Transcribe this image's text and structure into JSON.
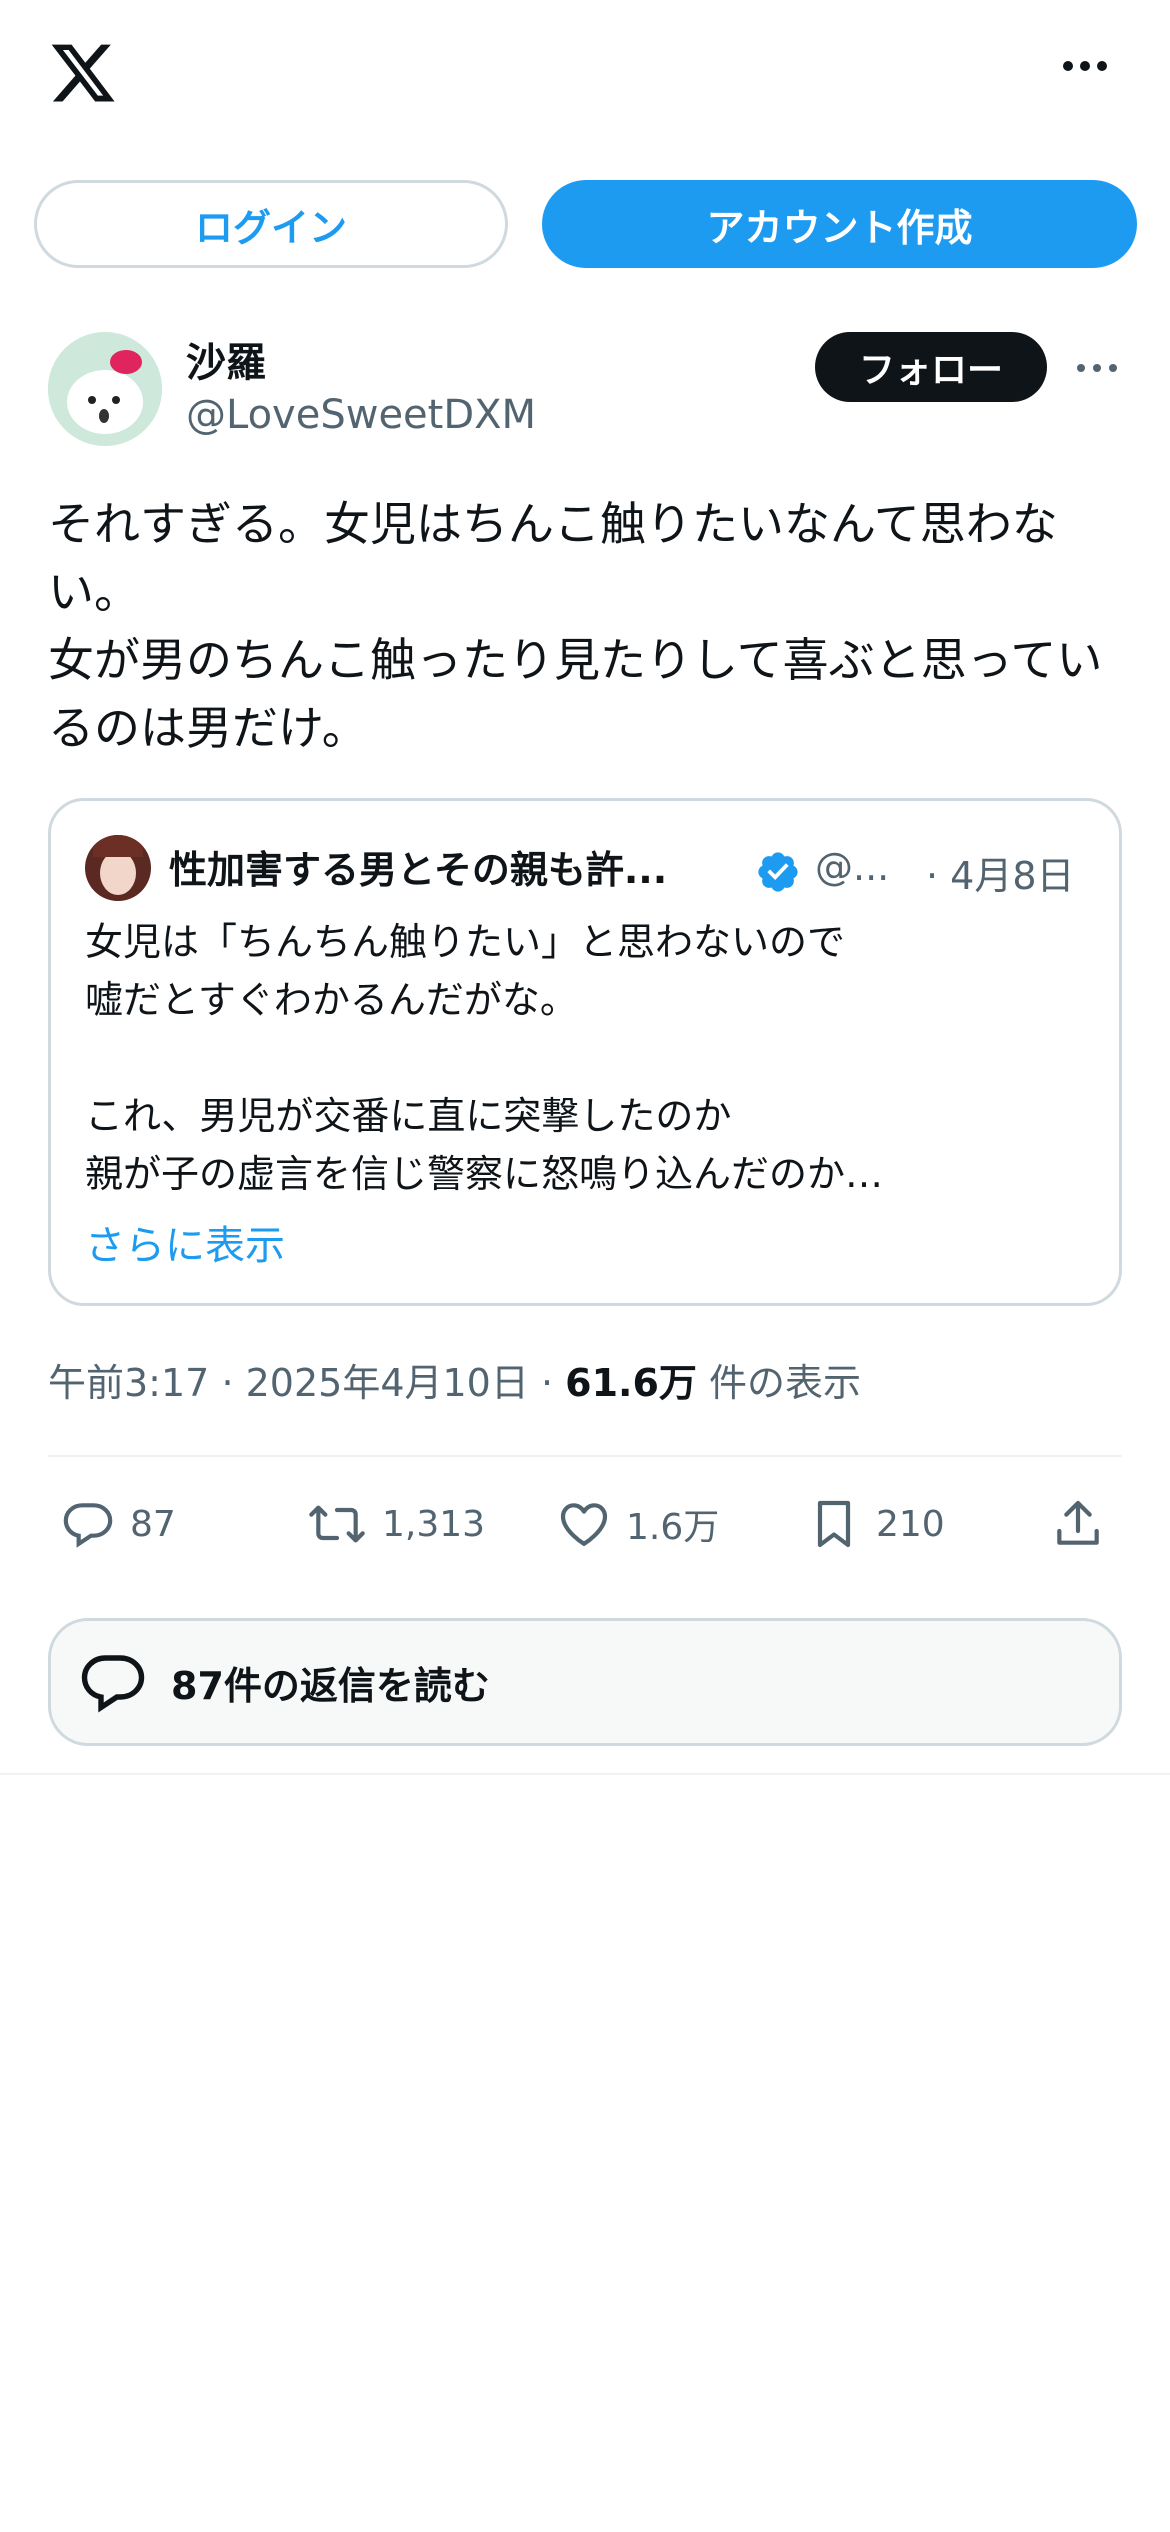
{
  "header": {
    "login_label": "ログイン",
    "signup_label": "アカウント作成"
  },
  "author": {
    "name": "沙羅",
    "handle": "@LoveSweetDXM",
    "follow_label": "フォロー"
  },
  "tweet": {
    "text": "それすぎる。女児はちんこ触りたいなんて思わない。\n女が男のちんこ触ったり見たりして喜ぶと思っているのは男だけ。"
  },
  "quote": {
    "name": "性加害する男とその親も許...",
    "handle": "@...",
    "date": "· 4月8日",
    "text": "女児は「ちんちん触りたい」と思わないので\n嘘だとすぐわかるんだがな。\n\nこれ、男児が交番に直に突撃したのか\n親が子の虚言を信じ警察に怒鳴り込んだのか…",
    "show_more": "さらに表示"
  },
  "meta": {
    "time": "午前3:17",
    "date": "2025年4月10日",
    "views_count": "61.6万",
    "views_label": "件の表示",
    "separator": "·"
  },
  "actions": {
    "replies": "87",
    "reposts": "1,313",
    "likes": "1.6万",
    "bookmarks": "210"
  },
  "read_replies_label": "87件の返信を読む",
  "colors": {
    "accent": "#1d9bf0",
    "text": "#0f1419",
    "secondary": "#536471",
    "border": "#cfd9de"
  }
}
